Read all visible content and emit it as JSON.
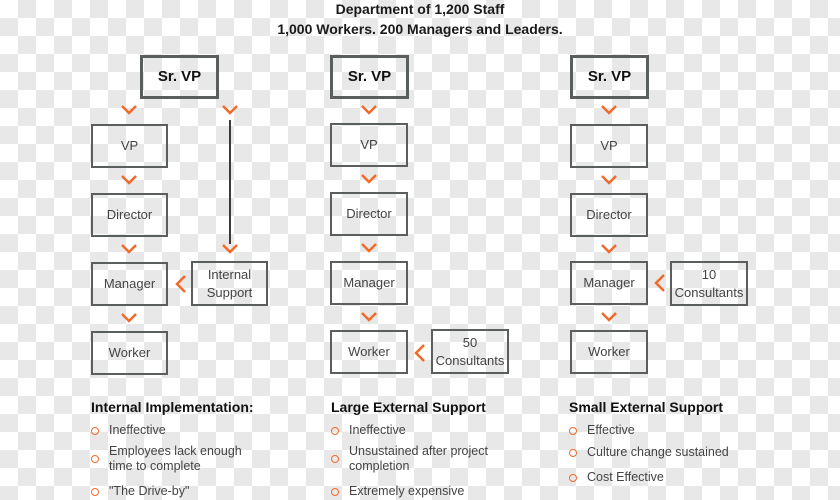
{
  "title": {
    "line1": "Department of 1,200 Staff",
    "line2": "1,000 Workers. 200 Managers and Leaders."
  },
  "colors": {
    "accent": "#f26a2a",
    "box_border": "#5a5e5d"
  },
  "columns": [
    {
      "hierarchy": [
        "Sr. VP",
        "VP",
        "Director",
        "Manager",
        "Worker"
      ],
      "support": {
        "line1": "Internal",
        "line2": "Support",
        "attaches_to": "Manager"
      },
      "heading": "Internal Implementation:",
      "bullets": [
        "Ineffective",
        "Employees lack enough time to complete",
        "\"The Drive-by\""
      ]
    },
    {
      "hierarchy": [
        "Sr. VP",
        "VP",
        "Director",
        "Manager",
        "Worker"
      ],
      "support": {
        "line1": "50",
        "line2": "Consultants",
        "attaches_to": "Worker"
      },
      "heading": "Large External Support",
      "bullets": [
        "Ineffective",
        "Unsustained after project completion",
        "Extremely expensive"
      ]
    },
    {
      "hierarchy": [
        "Sr. VP",
        "VP",
        "Director",
        "Manager",
        "Worker"
      ],
      "support": {
        "line1": "10",
        "line2": "Consultants",
        "attaches_to": "Manager"
      },
      "heading": "Small External Support",
      "bullets": [
        "Effective",
        "Culture change sustained",
        "Cost Effective"
      ]
    }
  ]
}
